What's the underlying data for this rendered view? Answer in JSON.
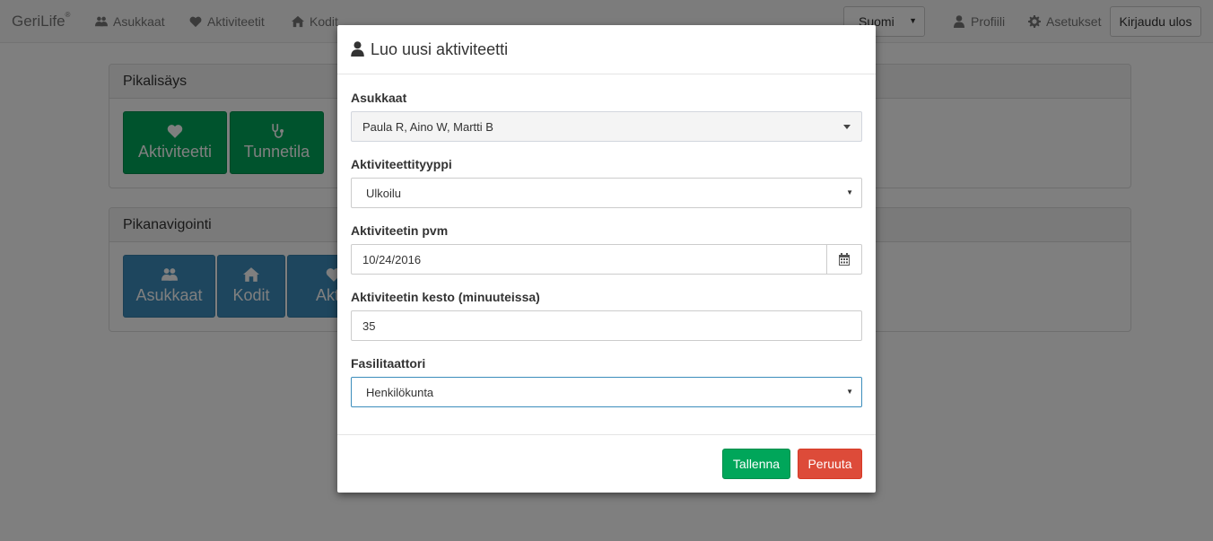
{
  "navbar": {
    "brand": "GeriLife",
    "brand_mark": "®",
    "items": [
      {
        "label": "Asukkaat",
        "icon": "users-icon"
      },
      {
        "label": "Aktiviteetit",
        "icon": "heartbeat-icon"
      },
      {
        "label": "Kodit",
        "icon": "home-icon"
      }
    ],
    "language": "Suomi",
    "profile_label": "Profiili",
    "settings_label": "Asetukset",
    "logout_label": "Kirjaudu ulos"
  },
  "quick_add": {
    "title": "Pikalisäys",
    "tiles": [
      {
        "label": "Aktiviteetti",
        "icon": "heartbeat-icon"
      },
      {
        "label": "Tunnetila",
        "icon": "stethoscope-icon"
      }
    ]
  },
  "quick_nav": {
    "title": "Pikanavigointi",
    "tiles": [
      {
        "label": "Asukkaat",
        "icon": "users-icon"
      },
      {
        "label": "Kodit",
        "icon": "home-icon"
      },
      {
        "label": "Aktiv",
        "icon": "heartbeat-icon"
      }
    ]
  },
  "modal": {
    "title": "Luo uusi aktiviteetti",
    "title_icon": "user-icon",
    "residents_label": "Asukkaat",
    "residents_value": "Paula R, Aino W, Martti B",
    "activity_type_label": "Aktiviteettityyppi",
    "activity_type_value": "Ulkoilu",
    "date_label": "Aktiviteetin pvm",
    "date_value": "10/24/2016",
    "duration_label": "Aktiviteetin kesto (minuuteissa)",
    "duration_value": "35",
    "facilitator_label": "Fasilitaattori",
    "facilitator_value": "Henkilökunta",
    "save_label": "Tallenna",
    "cancel_label": "Peruuta"
  }
}
